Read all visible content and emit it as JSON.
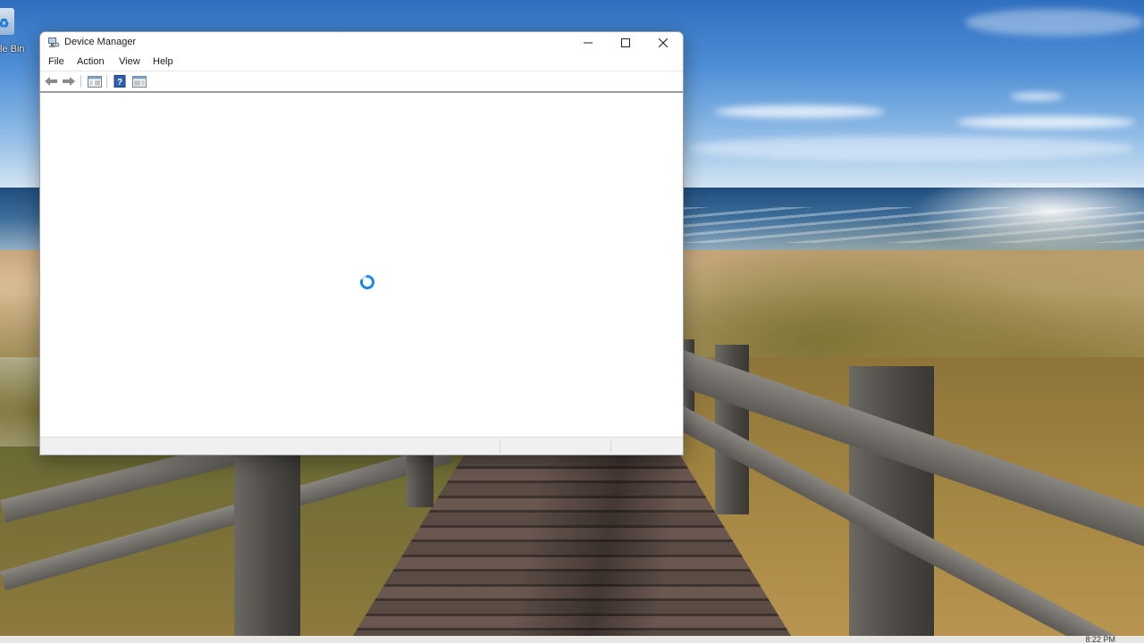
{
  "desktop": {
    "recycle_bin_label": "le Bin",
    "clock_text": "8:22 PM"
  },
  "window": {
    "title": "Device Manager",
    "controls": {
      "minimize": "minimize",
      "maximize": "maximize",
      "close": "close"
    },
    "menu": [
      "File",
      "Action",
      "View",
      "Help"
    ],
    "toolbar_icons": [
      "back-arrow-icon",
      "forward-arrow-icon",
      "properties-icon",
      "help-icon",
      "console-tree-icon"
    ],
    "status": "loading"
  },
  "colors": {
    "spinner": "#1e88e5",
    "window_border": "#9aa0a6"
  }
}
